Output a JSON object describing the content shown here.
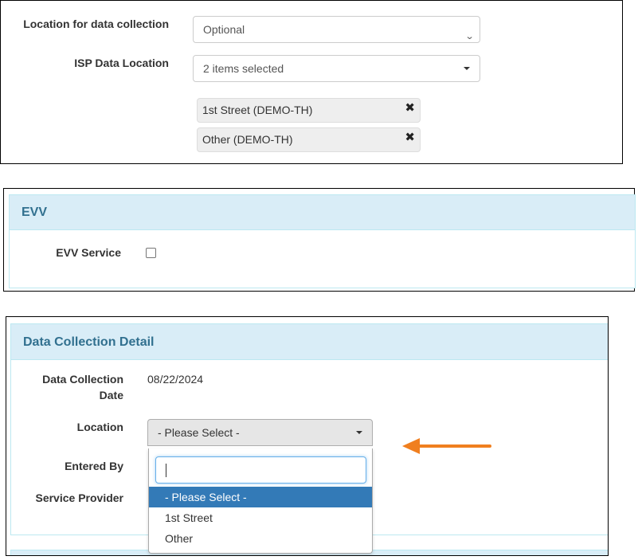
{
  "section1": {
    "location_label": "Location for data collection",
    "location_value": "Optional",
    "isp_label": "ISP Data Location",
    "isp_value": "2 items selected",
    "chips": [
      {
        "label": "1st Street (DEMO-TH)"
      },
      {
        "label": "Other (DEMO-TH)"
      }
    ]
  },
  "evv": {
    "title": "EVV",
    "service_label": "EVV Service",
    "service_checked": false
  },
  "detail": {
    "title": "Data Collection Detail",
    "date_label_line1": "Data Collection",
    "date_label_line2": "Date",
    "date_value": "08/22/2024",
    "location_label": "Location",
    "location_value": "- Please Select -",
    "entered_by_label": "Entered By",
    "service_provider_label": "Service Provider",
    "dropdown": {
      "search_value": "",
      "options": [
        {
          "label": "- Please Select -",
          "active": true
        },
        {
          "label": "1st Street",
          "active": false
        },
        {
          "label": "Other",
          "active": false
        }
      ]
    }
  },
  "colors": {
    "panel_heading_bg": "#d9edf7",
    "panel_heading_text": "#31708f",
    "highlight": "#337ab7",
    "arrow": "#f07f1f"
  },
  "icons": [
    "chevron-down-icon",
    "caret-down-icon",
    "remove-icon",
    "arrow-left-icon"
  ]
}
